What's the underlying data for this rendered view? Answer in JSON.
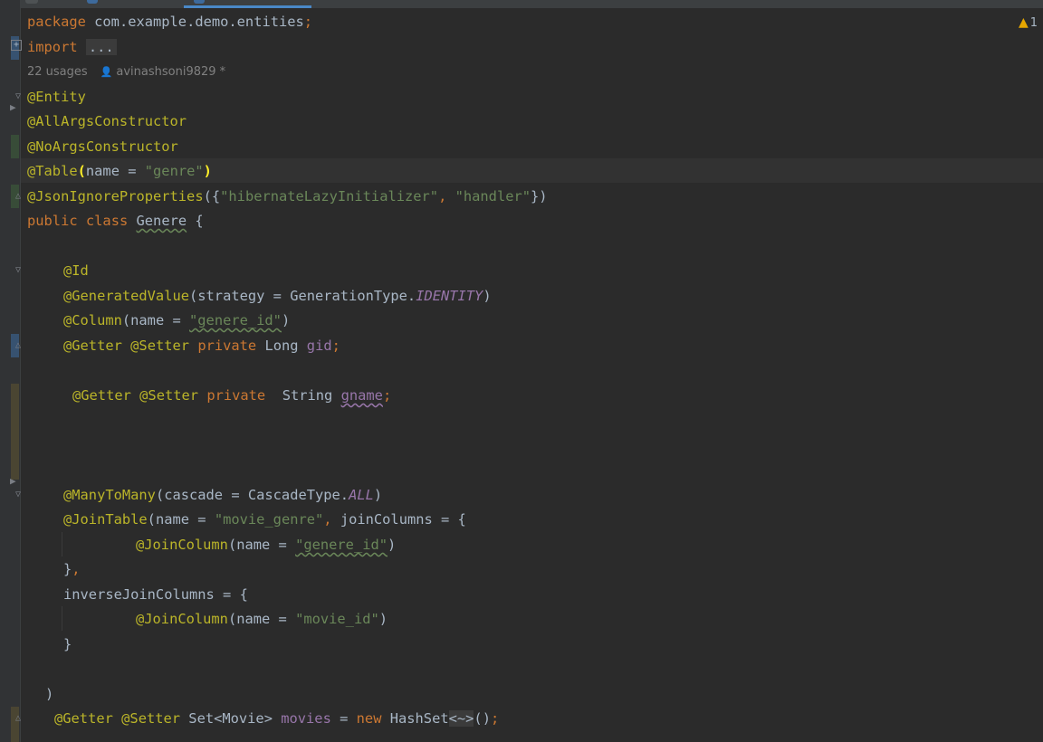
{
  "editor": {
    "lines": {
      "package": {
        "kw": "package",
        "name": " com.example.demo.entities",
        "semi": ";"
      },
      "import": {
        "kw": "import",
        "fold": "..."
      },
      "entity": "@Entity",
      "allargs": "@AllArgsConstructor",
      "noargs": "@NoArgsConstructor",
      "table": {
        "ann": "@Table",
        "open": "(",
        "arg": "name = ",
        "val": "\"genre\"",
        "close": ")"
      },
      "jsonignore": {
        "ann": "@JsonIgnoreProperties",
        "open": "({",
        "val1": "\"hibernateLazyInitializer\"",
        "comma": ", ",
        "val2": "\"handler\"",
        "close": "})"
      },
      "classdecl": {
        "mod": "public",
        "kw": "class",
        "name": "Genere",
        "brace": " {"
      },
      "id": "@Id",
      "generated": {
        "ann": "@GeneratedValue",
        "open": "(strategy = GenerationType.",
        "const": "IDENTITY",
        "close": ")"
      },
      "column": {
        "ann": "@Column",
        "open": "(name = ",
        "val": "\"genere_id\"",
        "close": ")"
      },
      "gid": {
        "getter": "@Getter",
        "setter": "@Setter",
        "mod": "private",
        "type": " Long ",
        "field": "gid",
        "semi": ";"
      },
      "gname": {
        "getter": "@Getter",
        "setter": "@Setter",
        "mod": "private",
        "type": "  String ",
        "field": "gname",
        "semi": ";"
      },
      "manytomany": {
        "ann": "@ManyToMany",
        "open": "(cascade = CascadeType.",
        "const": "ALL",
        "close": ")"
      },
      "jointable": {
        "ann": "@JoinTable",
        "open": "(name = ",
        "val": "\"movie_genre\"",
        "comma": ", ",
        "rest": "joinColumns = {"
      },
      "joincolumn1": {
        "ann": "@JoinColumn",
        "open": "(name = ",
        "val": "\"genere_id\"",
        "close": ")"
      },
      "close1": {
        "brace": "}",
        "comma": ","
      },
      "inverse": "inverseJoinColumns = {",
      "joincolumn2": {
        "ann": "@JoinColumn",
        "open": "(name = ",
        "val": "\"movie_id\"",
        "close": ")"
      },
      "close2": "}",
      "paren": ")",
      "movies": {
        "getter": "@Getter",
        "setter": "@Setter",
        "type": " Set<Movie> ",
        "field": "movies",
        "eq": " = ",
        "kw": "new",
        "cls": " HashSet",
        "diamond": "<~>",
        "end": "()",
        "semi": ";"
      }
    },
    "usages": "22 usages",
    "author": "avinashsoni9829 *",
    "warnings_count": "1"
  },
  "colors": {
    "keyword": "#cc7832",
    "annotation": "#bbb529",
    "string": "#6a8759",
    "field": "#9876aa",
    "text": "#a9b7c6",
    "background": "#2b2b2b"
  }
}
